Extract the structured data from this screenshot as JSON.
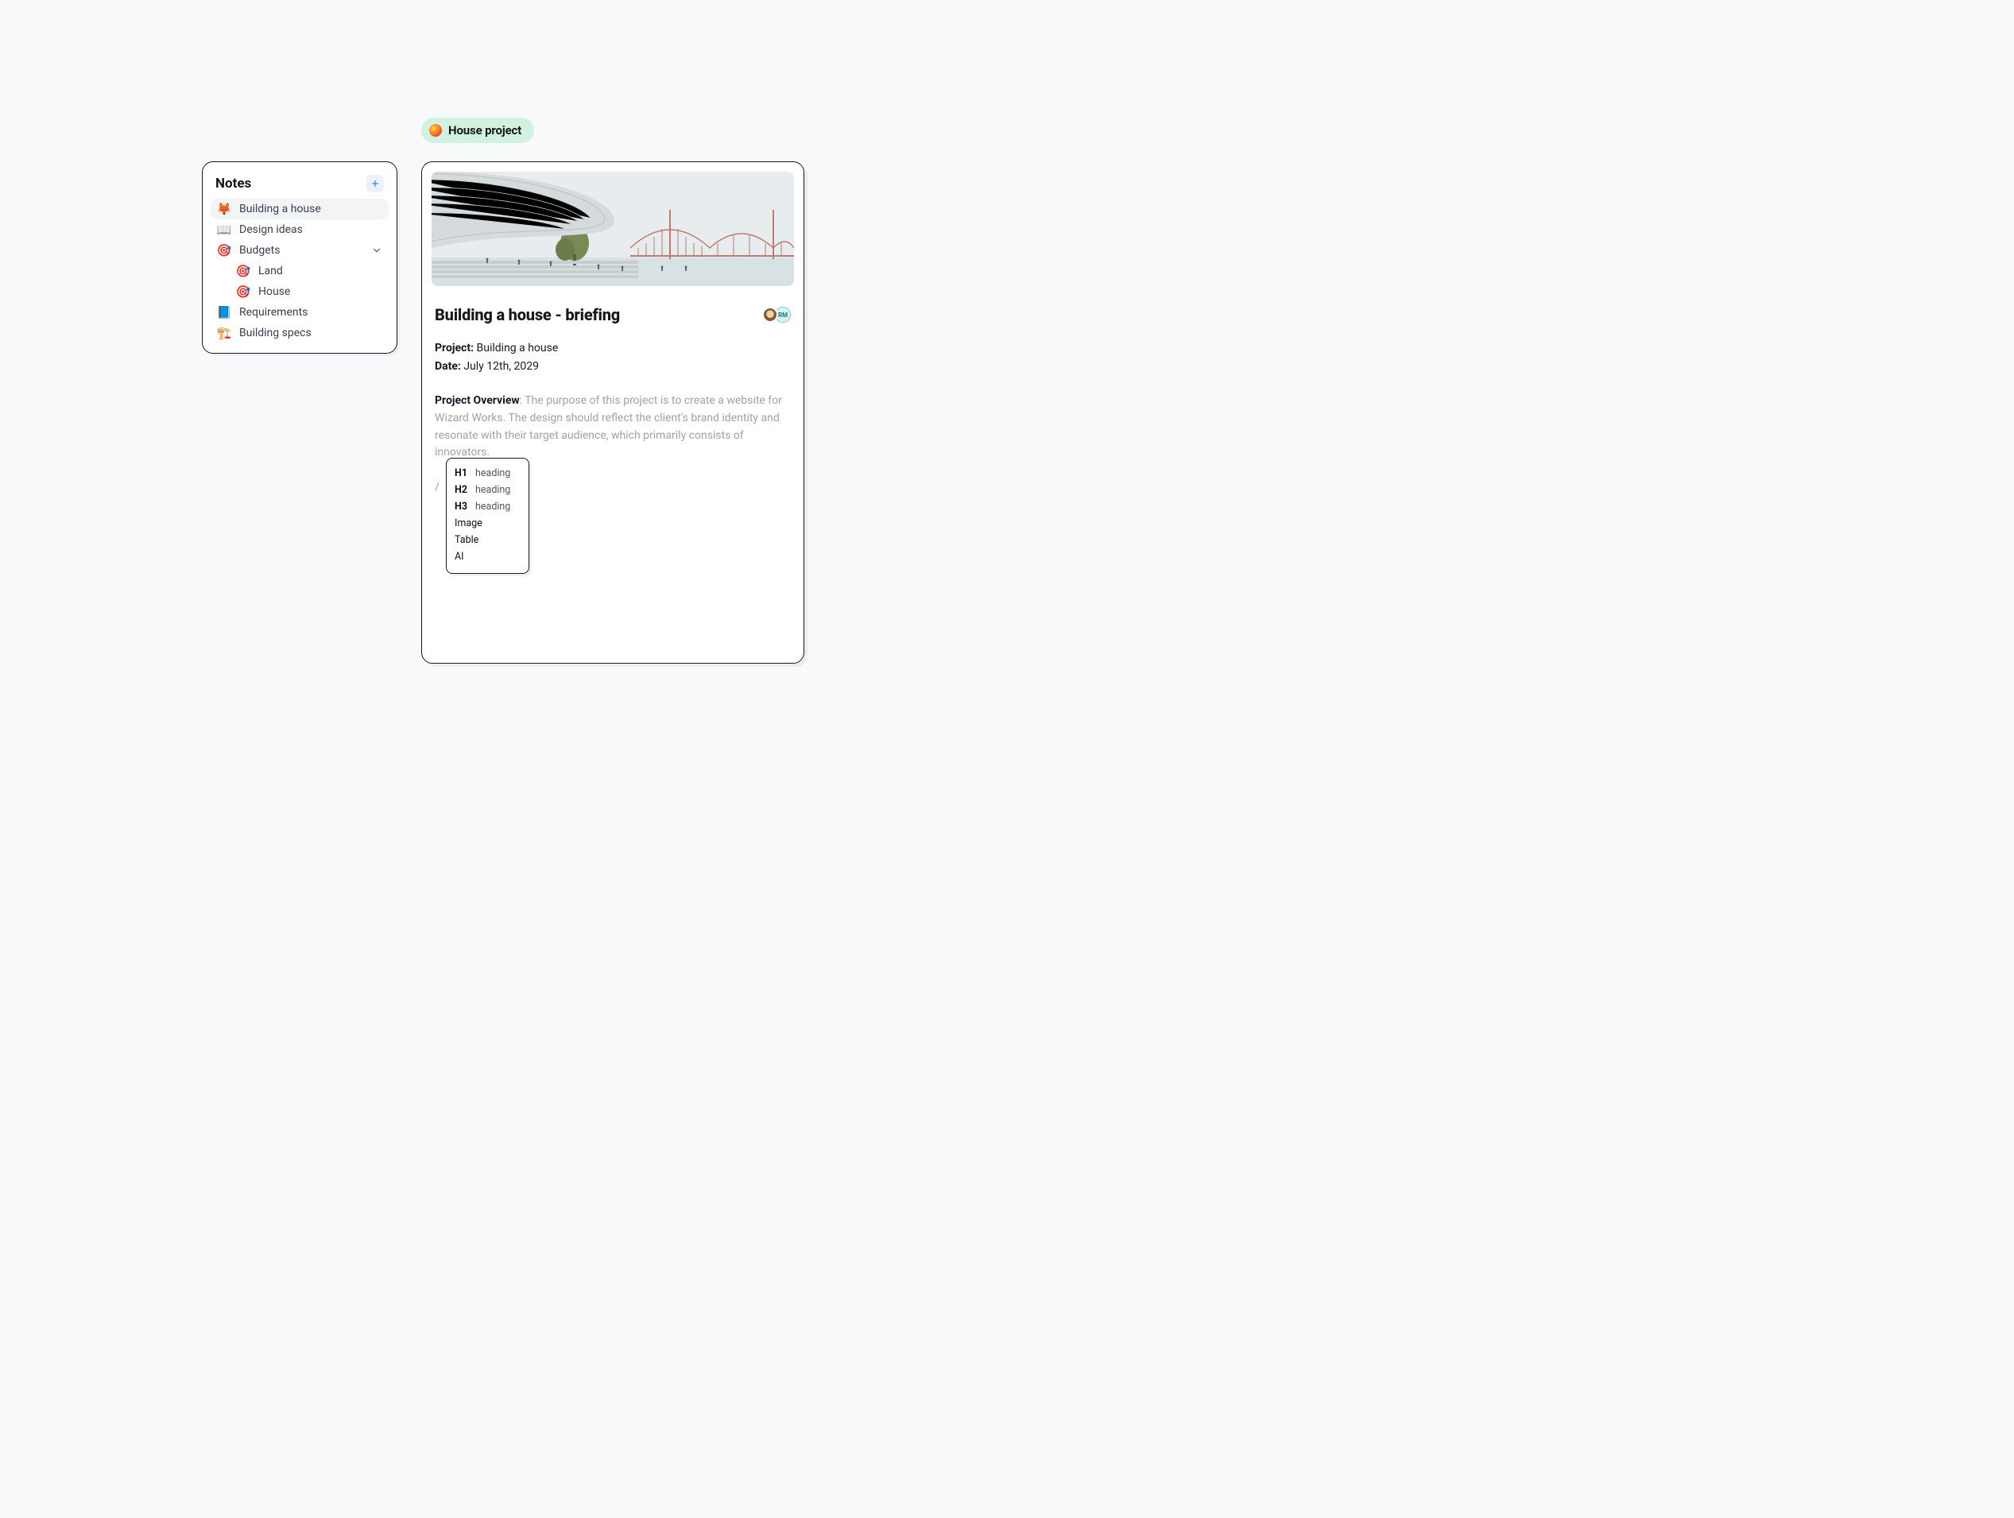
{
  "project": {
    "label": "House project"
  },
  "notes": {
    "title": "Notes",
    "items": [
      {
        "icon": "🦊",
        "label": "Building a house",
        "selected": true
      },
      {
        "icon": "📖",
        "label": "Design ideas"
      },
      {
        "icon": "🎯",
        "label": "Budgets",
        "hasChildren": true
      },
      {
        "icon": "🎯",
        "label": "Land",
        "child": true
      },
      {
        "icon": "🎯",
        "label": "House",
        "child": true
      },
      {
        "icon": "📘",
        "label": "Requirements"
      },
      {
        "icon": "🏗️",
        "label": "Building specs"
      }
    ]
  },
  "document": {
    "title": "Building a house - briefing",
    "collaborator_initials": "RM",
    "meta": {
      "project_key": "Project:",
      "project_val": "Building a house",
      "date_key": "Date:",
      "date_val": "July 12th, 2029"
    },
    "overview": {
      "key": "Project Overview",
      "text": ": The purpose of this project is to create a website for Wizard Works. The design should reflect the client's brand identity and resonate with their target audience, which primarily consists of innovators."
    },
    "slash": "/",
    "menu": {
      "h1_pre": "H1",
      "h1_lbl": "heading",
      "h2_pre": "H2",
      "h2_lbl": "heading",
      "h3_pre": "H3",
      "h3_lbl": "heading",
      "image": "Image",
      "table": "Table",
      "ai": "AI"
    }
  }
}
